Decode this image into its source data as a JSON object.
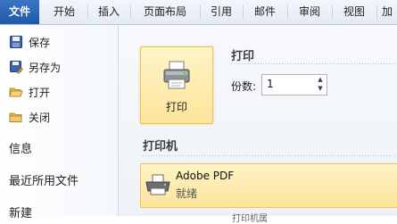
{
  "ribbon": {
    "tabs": [
      {
        "label": "文件"
      },
      {
        "label": "开始"
      },
      {
        "label": "插入"
      },
      {
        "label": "页面布局"
      },
      {
        "label": "引用"
      },
      {
        "label": "邮件"
      },
      {
        "label": "审阅"
      },
      {
        "label": "视图"
      },
      {
        "label": "加"
      }
    ]
  },
  "sidebar": {
    "items": [
      {
        "label": "保存",
        "icon": "save-icon"
      },
      {
        "label": "另存为",
        "icon": "save-as-icon"
      },
      {
        "label": "打开",
        "icon": "open-folder-icon"
      },
      {
        "label": "关闭",
        "icon": "close-folder-icon"
      }
    ],
    "sections": [
      {
        "label": "信息"
      },
      {
        "label": "最近所用文件"
      },
      {
        "label": "新建"
      }
    ]
  },
  "print": {
    "heading": "打印",
    "button_label": "打印",
    "copies_label": "份数:",
    "copies_value": "1"
  },
  "printer": {
    "heading": "打印机",
    "name": "Adobe PDF",
    "status": "就绪",
    "properties_link": "打印机属"
  }
}
